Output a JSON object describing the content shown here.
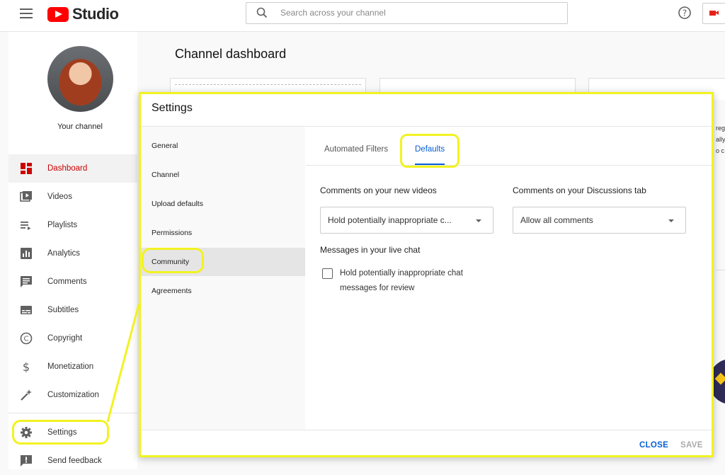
{
  "topbar": {
    "brand": "Studio",
    "search_placeholder": "Search across your channel",
    "icons": [
      "menu-icon",
      "youtube-logo",
      "search-icon",
      "help-icon",
      "create-video-icon"
    ]
  },
  "sidebar": {
    "channel_label": "Your channel",
    "items": [
      {
        "label": "Dashboard",
        "icon": "dashboard-icon",
        "active": true
      },
      {
        "label": "Videos",
        "icon": "videos-icon"
      },
      {
        "label": "Playlists",
        "icon": "playlists-icon"
      },
      {
        "label": "Analytics",
        "icon": "analytics-icon"
      },
      {
        "label": "Comments",
        "icon": "comments-icon"
      },
      {
        "label": "Subtitles",
        "icon": "subtitles-icon"
      },
      {
        "label": "Copyright",
        "icon": "copyright-icon"
      },
      {
        "label": "Monetization",
        "icon": "dollar-icon"
      },
      {
        "label": "Customization",
        "icon": "magic-wand-icon"
      },
      {
        "label": "Settings",
        "icon": "gear-icon"
      },
      {
        "label": "Send feedback",
        "icon": "feedback-icon"
      }
    ]
  },
  "main": {
    "title": "Channel dashboard",
    "right_fragments": [
      "reg",
      "ally",
      "o c"
    ]
  },
  "dialog": {
    "title": "Settings",
    "nav": [
      {
        "label": "General"
      },
      {
        "label": "Channel"
      },
      {
        "label": "Upload defaults"
      },
      {
        "label": "Permissions"
      },
      {
        "label": "Community",
        "selected": true
      },
      {
        "label": "Agreements"
      }
    ],
    "tabs": [
      {
        "label": "Automated Filters"
      },
      {
        "label": "Defaults",
        "active": true
      }
    ],
    "new_videos_label": "Comments on your new videos",
    "new_videos_value": "Hold potentially inappropriate c...",
    "discussions_label": "Comments on your Discussions tab",
    "discussions_value": "Allow all comments",
    "live_chat_label": "Messages in your live chat",
    "live_chat_checkbox_label": "Hold potentially inappropriate chat messages for review",
    "live_chat_checked": false,
    "close_label": "CLOSE",
    "save_label": "SAVE"
  },
  "colors": {
    "highlight": "#f2f222",
    "accent": "#065fd4",
    "brand_red": "#ff0000",
    "active_nav": "#cc0000"
  }
}
